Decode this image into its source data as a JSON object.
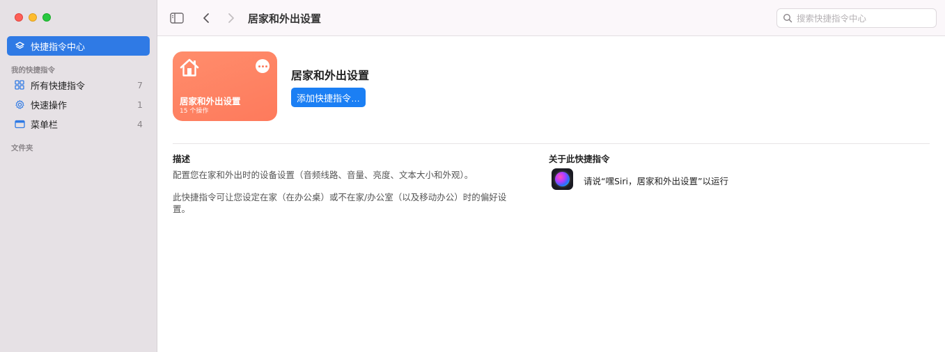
{
  "sidebar": {
    "gallery_label": "快捷指令中心",
    "section_my_shortcuts": "我的快捷指令",
    "items": [
      {
        "label": "所有快捷指令",
        "count": "7",
        "icon": "grid-icon"
      },
      {
        "label": "快速操作",
        "count": "1",
        "icon": "gear-icon"
      },
      {
        "label": "菜单栏",
        "count": "4",
        "icon": "menubar-window-icon"
      }
    ],
    "section_folders": "文件夹"
  },
  "toolbar": {
    "title": "居家和外出设置",
    "search_placeholder": "搜索快捷指令中心"
  },
  "card": {
    "title": "居家和外出设置",
    "subtitle": "15 个操作",
    "color": "#fe7a5c"
  },
  "main": {
    "title": "居家和外出设置",
    "add_button": "添加快捷指令…"
  },
  "description": {
    "heading": "描述",
    "paragraph1": "配置您在家和外出时的设备设置（音频线路、音量、亮度、文本大小和外观）。",
    "paragraph2": "此快捷指令可让您设定在家（在办公桌）或不在家/办公室（以及移动办公）时的偏好设置。"
  },
  "about": {
    "heading": "关于此快捷指令",
    "siri_text": "请说“嘿Siri，居家和外出设置”以运行"
  },
  "colors": {
    "accent": "#2f7ae5",
    "button": "#1b7ff4",
    "sidebar_bg": "#e6e1e5"
  }
}
